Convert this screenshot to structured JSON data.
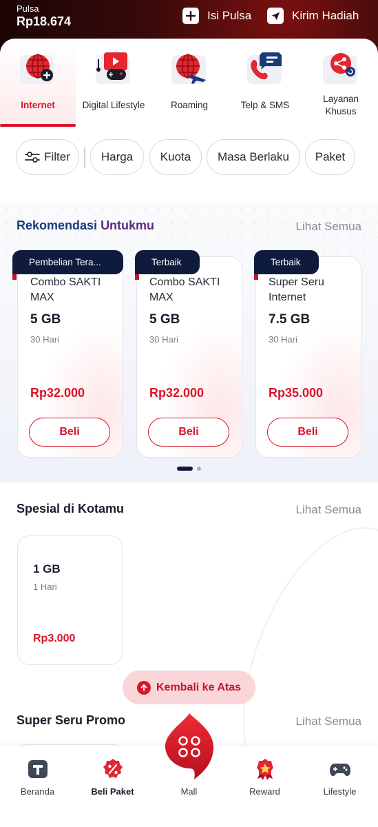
{
  "header": {
    "pulsa_label": "Pulsa",
    "pulsa_value": "Rp18.674",
    "actions": [
      {
        "label": "Isi Pulsa",
        "icon": "plus-icon"
      },
      {
        "label": "Kirim Hadiah",
        "icon": "send-icon"
      }
    ]
  },
  "categories": [
    {
      "label": "Internet",
      "icon": "globe-plus-icon",
      "active": true
    },
    {
      "label": "Digital Lifestyle",
      "icon": "media-gamepad-icon",
      "active": false
    },
    {
      "label": "Roaming",
      "icon": "globe-plane-icon",
      "active": false
    },
    {
      "label": "Telp & SMS",
      "icon": "phone-chat-icon",
      "active": false
    },
    {
      "label": "Layanan Khusus",
      "icon": "share-network-icon",
      "active": false
    }
  ],
  "filters": {
    "filter_label": "Filter",
    "chips": [
      "Harga",
      "Kuota",
      "Masa Berlaku",
      "Paket"
    ]
  },
  "rekomendasi": {
    "title_part1": "Rekomendasi",
    "title_part2": "Untukmu",
    "link": "Lihat Semua",
    "cards": [
      {
        "badge": "Pembelian Tera...",
        "name": "Combo SAKTI MAX",
        "quota": "5 GB",
        "days": "30 Hari",
        "price": "Rp32.000",
        "button": "Beli"
      },
      {
        "badge": "Terbaik",
        "name": "Combo SAKTI MAX",
        "quota": "5 GB",
        "days": "30 Hari",
        "price": "Rp32.000",
        "button": "Beli"
      },
      {
        "badge": "Terbaik",
        "name": "Super Seru Internet",
        "quota": "7.5 GB",
        "days": "30 Hari",
        "price": "Rp35.000",
        "button": "Beli"
      }
    ],
    "pager": {
      "pages": 2,
      "current": 1
    }
  },
  "spesial": {
    "title": "Spesial di Kotamu",
    "link": "Lihat Semua",
    "cards": [
      {
        "quota": "1 GB",
        "days": "1 Hari",
        "price": "Rp3.000"
      }
    ]
  },
  "back_to_top": "Kembali ke Atas",
  "promo": {
    "title": "Super Seru Promo",
    "link": "Lihat Semua"
  },
  "bottom_nav": [
    {
      "label": "Beranda",
      "icon": "home-t-icon",
      "active": false
    },
    {
      "label": "Beli Paket",
      "icon": "discount-icon",
      "active": true
    },
    {
      "label": "Mall",
      "icon": "mall-icon",
      "active": false
    },
    {
      "label": "Reward",
      "icon": "medal-icon",
      "active": false
    },
    {
      "label": "Lifestyle",
      "icon": "gamepad-icon",
      "active": false
    }
  ],
  "colors": {
    "accent": "#d9142b",
    "navy": "#0f1b3d",
    "header_dark": "#3a0a0a"
  }
}
